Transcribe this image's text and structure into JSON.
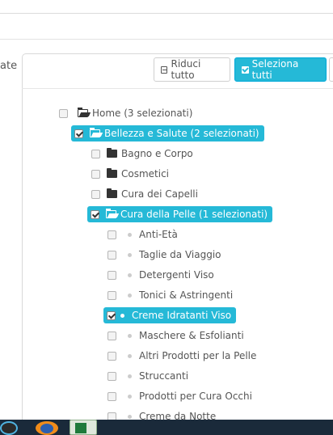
{
  "side_label": "ate",
  "toolbar": {
    "collapse_label": "Riduci tutto",
    "select_all_label": "Seleziona tutti"
  },
  "tree": {
    "home": "Home (3 selezionati)",
    "bellezza": "Bellezza e Salute (2 selezionati)",
    "bagno": "Bagno e Corpo",
    "cosmetici": "Cosmetici",
    "capelli": "Cura dei Capelli",
    "pelle": "Cura della Pelle (1 selezionati)",
    "antieta": "Anti-Età",
    "taglie": "Taglie da Viaggio",
    "detergenti": "Detergenti Viso",
    "tonici": "Tonici & Astringenti",
    "creme": "Creme Idratanti Viso",
    "maschere": "Maschere & Esfolianti",
    "altri": "Altri Prodotti per la Pelle",
    "struccanti": "Struccanti",
    "occhi": "Prodotti per Cura Occhi",
    "notte": "Creme da Notte"
  },
  "colors": {
    "accent": "#25b9d7",
    "taskbar": "#1a2a3a"
  }
}
